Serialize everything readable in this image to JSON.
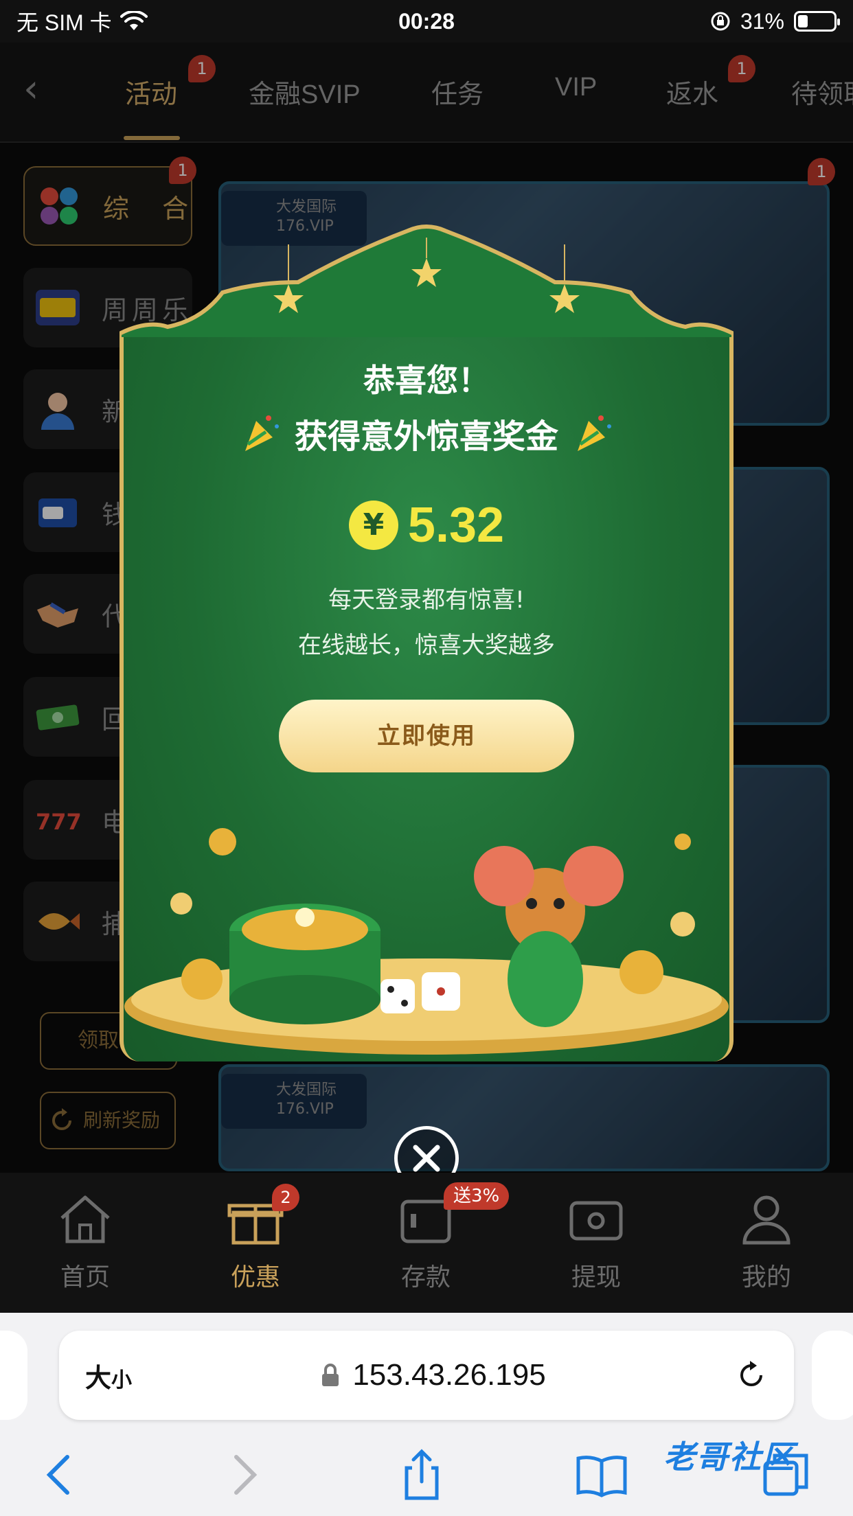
{
  "status_bar": {
    "carrier": "无 SIM 卡",
    "time": "00:28",
    "battery": "31%"
  },
  "top_tabs": [
    {
      "label": "活动",
      "badge": "1",
      "active": true
    },
    {
      "label": "金融SVIP",
      "badge": ""
    },
    {
      "label": "任务",
      "badge": ""
    },
    {
      "label": "VIP",
      "badge": ""
    },
    {
      "label": "返水",
      "badge": "1"
    },
    {
      "label": "待领取",
      "badge": ""
    }
  ],
  "sidebar": {
    "items": [
      {
        "label": "综 合",
        "badge": "1",
        "active": true,
        "icon": "grid-icon"
      },
      {
        "label": "周周乐",
        "icon": "weekly-fun-icon"
      },
      {
        "label": "新",
        "icon": "user-icon"
      },
      {
        "label": "钱",
        "icon": "wallet-icon"
      },
      {
        "label": "代",
        "icon": "handshake-icon"
      },
      {
        "label": "回",
        "icon": "cash-icon"
      },
      {
        "label": "电",
        "icon": "slot-777-icon"
      },
      {
        "label": "捕",
        "icon": "fish-icon"
      }
    ],
    "claim_button": "领取记",
    "refresh_button": "刷新奖励"
  },
  "promo": {
    "badge": "1",
    "logo_text": "大发国际",
    "logo_sub": "176.VIP"
  },
  "modal": {
    "line1": "恭喜您！",
    "line2": "获得意外惊喜奖金",
    "currency_symbol": "¥",
    "amount": "5.32",
    "msg1": "每天登录都有惊喜!",
    "msg2": "在线越长，惊喜大奖越多",
    "button": "立即使用"
  },
  "tabbar": [
    {
      "label": "首页",
      "icon": "home-icon"
    },
    {
      "label": "优惠",
      "icon": "gift-icon",
      "badge": "2",
      "active": true
    },
    {
      "label": "存款",
      "icon": "deposit-wallet-icon",
      "badge": "送3%"
    },
    {
      "label": "提现",
      "icon": "withdraw-icon"
    },
    {
      "label": "我的",
      "icon": "profile-icon"
    }
  ],
  "safari": {
    "text_size": "大",
    "text_size_small": "小",
    "url": "153.43.26.195"
  },
  "watermark": "老哥社区"
}
